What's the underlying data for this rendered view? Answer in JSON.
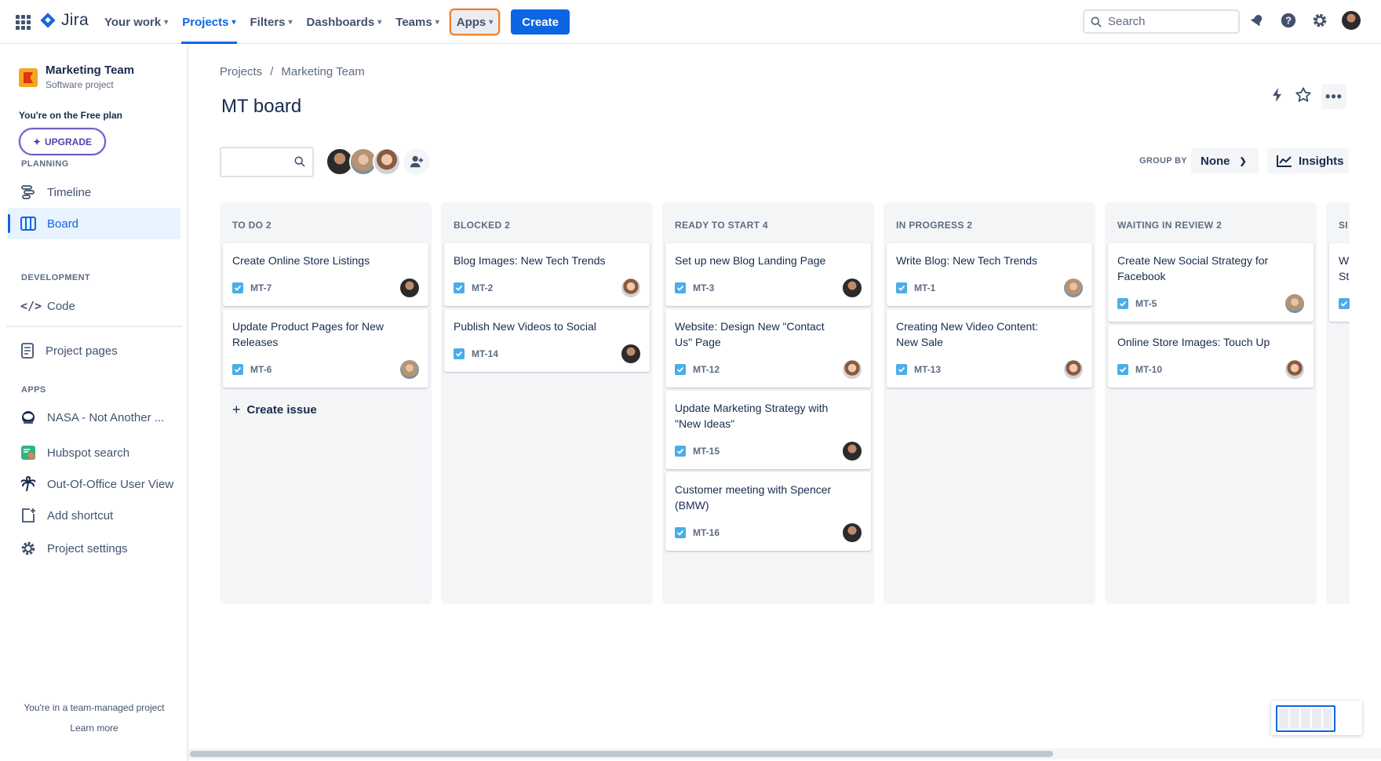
{
  "topbar": {
    "logo_text": "Jira",
    "nav": [
      {
        "label": "Your work"
      },
      {
        "label": "Projects"
      },
      {
        "label": "Filters"
      },
      {
        "label": "Dashboards"
      },
      {
        "label": "Teams"
      },
      {
        "label": "Apps"
      }
    ],
    "create_label": "Create",
    "search_placeholder": "Search"
  },
  "sidebar": {
    "project_name": "Marketing Team",
    "project_type": "Software project",
    "plan_text": "You're on the Free plan",
    "upgrade_label": "UPGRADE",
    "planning_title": "PLANNING",
    "timeline_label": "Timeline",
    "board_label": "Board",
    "development_title": "DEVELOPMENT",
    "code_label": "Code",
    "project_pages_label": "Project pages",
    "apps_title": "APPS",
    "apps": [
      {
        "label": "NASA - Not Another ..."
      },
      {
        "label": "Hubspot search"
      },
      {
        "label": "Out-Of-Office User View"
      }
    ],
    "add_shortcut_label": "Add shortcut",
    "project_settings_label": "Project settings",
    "footer_text": "You're in a team-managed project",
    "learn_more": "Learn more"
  },
  "main": {
    "breadcrumb": [
      "Projects",
      "/",
      "Marketing Team"
    ],
    "title": "MT board",
    "group_by_label": "GROUP BY",
    "group_by_value": "None",
    "insights_label": "Insights"
  },
  "board": {
    "create_issue_label": "Create issue",
    "columns": [
      {
        "header": "TO DO 2",
        "cards": [
          {
            "title": "Create Online Store Listings",
            "key": "MT-7",
            "avatar": "dark"
          },
          {
            "title": "Update Product Pages for New Releases",
            "key": "MT-6",
            "avatar": "blonde"
          }
        ]
      },
      {
        "header": "BLOCKED 2",
        "cards": [
          {
            "title": "Blog Images: New Tech Trends",
            "key": "MT-2",
            "avatar": "light"
          },
          {
            "title": "Publish New Videos to Social",
            "key": "MT-14",
            "avatar": "dark"
          }
        ]
      },
      {
        "header": "READY TO START 4",
        "cards": [
          {
            "title": "Set up new Blog Landing Page",
            "key": "MT-3",
            "avatar": "dark"
          },
          {
            "title": "Website: Design New \"Contact Us\" Page",
            "key": "MT-12",
            "avatar": "light"
          },
          {
            "title": "Update Marketing Strategy with \"New Ideas\"",
            "key": "MT-15",
            "avatar": "dark"
          },
          {
            "title": "Customer meeting with Spencer (BMW)",
            "key": "MT-16",
            "avatar": "dark"
          }
        ]
      },
      {
        "header": "IN PROGRESS 2",
        "cards": [
          {
            "title": "Write Blog: New Tech Trends",
            "key": "MT-1",
            "avatar": "blonde"
          },
          {
            "title": "Creating New Video Content: New Sale",
            "key": "MT-13",
            "avatar": "light"
          }
        ]
      },
      {
        "header": "WAITING IN REVIEW 2",
        "cards": [
          {
            "title": "Create New Social Strategy for Facebook",
            "key": "MT-5",
            "avatar": "blonde"
          },
          {
            "title": "Online Store Images: Touch Up",
            "key": "MT-10",
            "avatar": "light"
          }
        ]
      }
    ],
    "partial_column": {
      "header": "SI",
      "card_title": "W St"
    }
  },
  "colors": {
    "accent": "#0c66e4",
    "apps_highlight": "#f08030",
    "upgrade": "#5243aa"
  }
}
